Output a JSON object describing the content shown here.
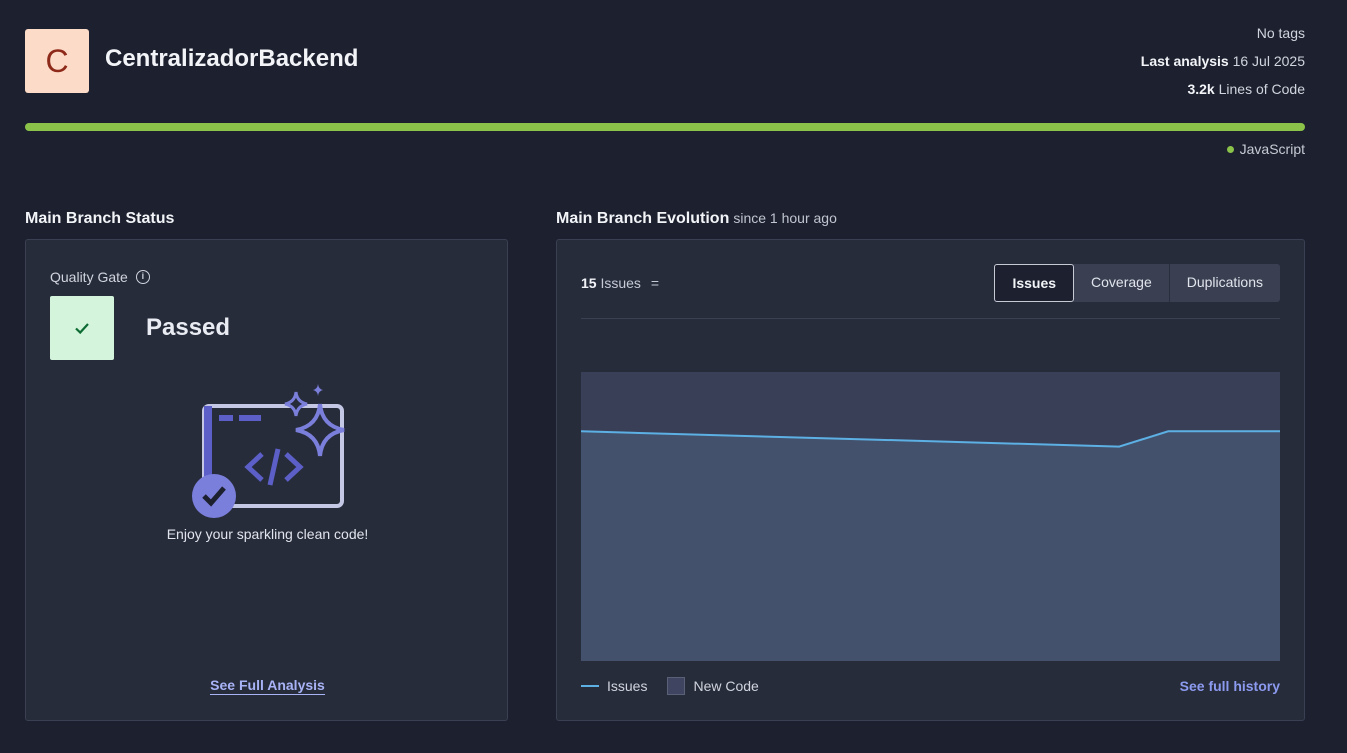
{
  "project": {
    "avatar_letter": "C",
    "name": "CentralizadorBackend",
    "tags": "No tags",
    "last_analysis_label": "Last analysis",
    "last_analysis_date": "16 Jul 2025",
    "loc_value": "3.2k",
    "loc_label": "Lines of Code",
    "language": "JavaScript",
    "language_color": "#8bc34a"
  },
  "status": {
    "title": "Main Branch Status",
    "quality_gate_label": "Quality Gate",
    "quality_gate_status": "Passed",
    "message": "Enjoy your sparkling clean code!",
    "see_full_analysis": "See Full Analysis"
  },
  "evolution": {
    "title": "Main Branch Evolution",
    "since": "since 1 hour ago",
    "issues_count": "15",
    "issues_label": "Issues",
    "issues_trend": "=",
    "tabs": [
      {
        "label": "Issues",
        "active": true
      },
      {
        "label": "Coverage",
        "active": false
      },
      {
        "label": "Duplications",
        "active": false
      }
    ],
    "legend_issues": "Issues",
    "legend_new_code": "New Code",
    "see_full_history": "See full history"
  },
  "chart_data": {
    "type": "line",
    "series": [
      {
        "name": "Issues",
        "values": [
          15,
          14,
          15,
          15
        ]
      }
    ],
    "x_fraction": [
      0,
      0.77,
      0.84,
      1
    ],
    "ylim": [
      0,
      19
    ],
    "new_code_region": true,
    "colors": {
      "line": "#5cb0e4",
      "fill": "#43516c",
      "new_code": "#3a3f58"
    }
  }
}
